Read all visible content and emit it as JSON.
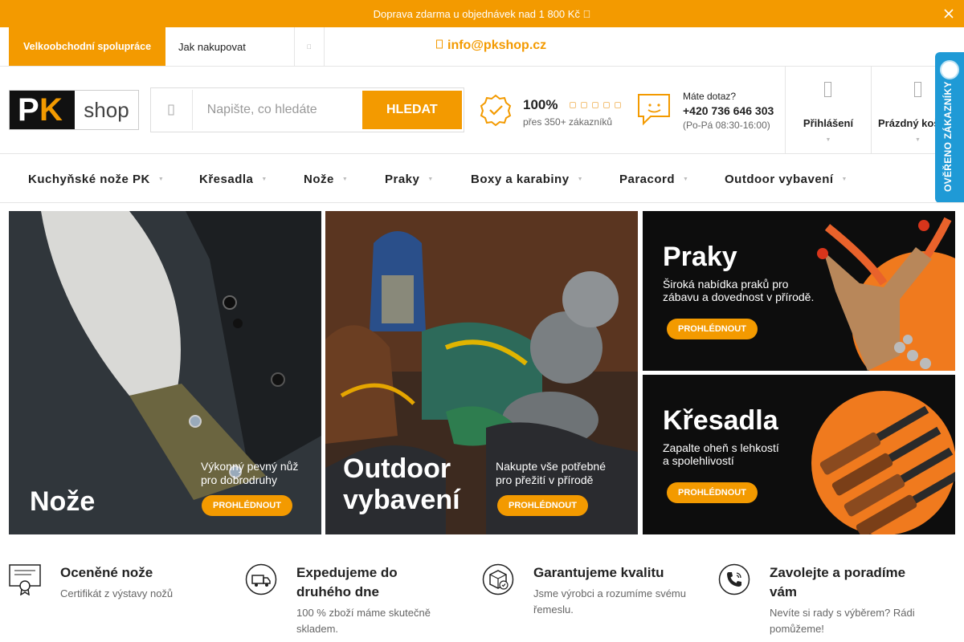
{
  "topbar": {
    "text": "Doprava zdarma u objednávek nad 1 800 Kč "
  },
  "subnav": {
    "wholesale": "Velkoobchodní spolupráce",
    "howto": "Jak nakupovat",
    "more": "",
    "email": "info@pkshop.cz"
  },
  "logo": {
    "p": "P",
    "k": "K",
    "word": "shop"
  },
  "search": {
    "placeholder": "Napište, co hledáte",
    "button": "HLEDAT"
  },
  "rating": {
    "percent": "100%",
    "subtitle": "přes 350+ zákazníků",
    "stars": 5
  },
  "contact": {
    "question": "Máte dotaz?",
    "phone": "+420 736 646 303",
    "hours": "(Po-Pá 08:30-16:00)"
  },
  "account": {
    "login": "Přihlášení",
    "cart": "Prázdný košík"
  },
  "verified": {
    "text": "OVĚŘENO ZÁKAZNÍKY"
  },
  "nav": [
    "Kuchyňské nože PK",
    "Křesadla",
    "Nože",
    "Praky",
    "Boxy a karabiny",
    "Paracord",
    "Outdoor vybavení"
  ],
  "banners": {
    "knife": {
      "title": "Nože",
      "sub1": "Výkonný pevný nůž",
      "sub2": "pro  dobrodruhy",
      "button": "PROHLÉDNOUT"
    },
    "outdoor": {
      "title1": "Outdoor",
      "title2": "vybavení",
      "sub1": "Nakupte vše potřebné",
      "sub2": "pro přežití v přírodě",
      "button": "PROHLÉDNOUT"
    },
    "praky": {
      "title": "Praky",
      "sub1": "Široká nabídka praků pro",
      "sub2": "zábavu a dovednost v přírodě.",
      "button": "PROHLÉDNOUT"
    },
    "kresadla": {
      "title": "Křesadla",
      "sub1": "Zapalte oheň s lehkostí",
      "sub2": "a spolehlivostí",
      "button": "PROHLÉDNOUT"
    }
  },
  "features": [
    {
      "title": "Oceněné nože",
      "desc": "Certifikát z výstavy nožů"
    },
    {
      "title": "Expedujeme do druhého dne",
      "desc": "100 % zboží máme skutečně skladem."
    },
    {
      "title": "Garantujeme kvalitu",
      "desc": "Jsme výrobci a rozumíme svému řemeslu."
    },
    {
      "title": "Zavolejte a poradíme vám",
      "desc": "Nevíte si rady s výběrem? Rádi pomůžeme!"
    }
  ],
  "colors": {
    "accent": "#f39a00",
    "verified": "#1f9ad6"
  }
}
